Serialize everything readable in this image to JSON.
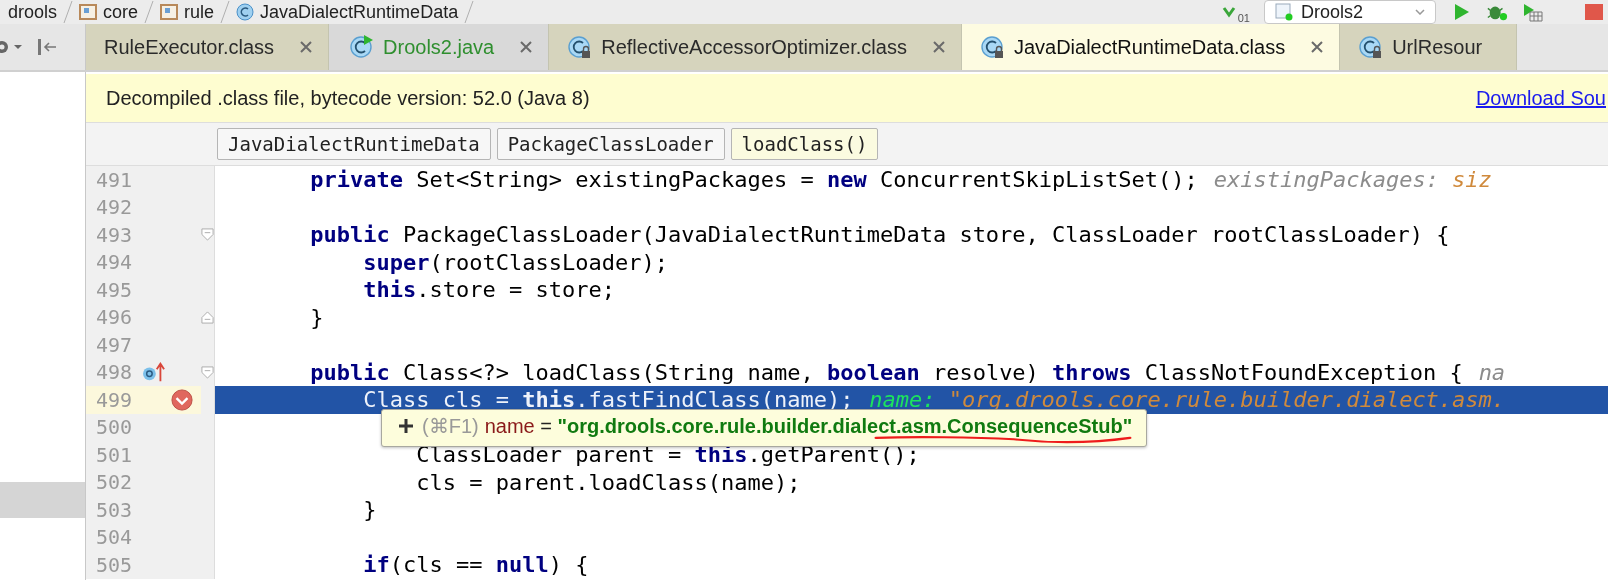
{
  "breadcrumbs": [
    {
      "label": "drools",
      "kind": "module"
    },
    {
      "label": "core",
      "kind": "package"
    },
    {
      "label": "rule",
      "kind": "package"
    },
    {
      "label": "JavaDialectRuntimeData",
      "kind": "class"
    }
  ],
  "toolbar": {
    "vcs_badge": "01",
    "run_config": "Drools2"
  },
  "tabs": [
    {
      "label": "RuleExecutor.class",
      "kind": "class",
      "icon": false,
      "closable": true,
      "selected": false
    },
    {
      "label": "Drools2.java",
      "kind": "java",
      "icon": true,
      "closable": true,
      "selected": false
    },
    {
      "label": "ReflectiveAccessorOptimizer.class",
      "kind": "class",
      "icon": true,
      "closable": true,
      "selected": false
    },
    {
      "label": "JavaDialectRuntimeData.class",
      "kind": "class",
      "icon": true,
      "closable": true,
      "selected": true
    },
    {
      "label": "UrlResour",
      "kind": "class",
      "icon": true,
      "closable": false,
      "selected": false
    }
  ],
  "banner": {
    "message": "Decompiled .class file, bytecode version: 52.0 (Java 8)",
    "link": "Download Sou"
  },
  "crumbs": [
    {
      "label": "JavaDialectRuntimeData",
      "selected": false
    },
    {
      "label": "PackageClassLoader",
      "selected": false
    },
    {
      "label": "loadClass()",
      "selected": true
    }
  ],
  "lines": [
    {
      "number": "491",
      "current": false,
      "fold_start": false,
      "fold_end": false,
      "override": false,
      "breakpoint": false,
      "tokens": [
        {
          "kind": "kw",
          "text": "private"
        },
        {
          "kind": "plain",
          "text": " Set<String> existingPackages = "
        },
        {
          "kind": "kw",
          "text": "new"
        },
        {
          "kind": "plain",
          "text": " ConcurrentSkipListSet();"
        }
      ],
      "hint": {
        "kind": "param",
        "label": "existingPackages:",
        "value": "siz"
      }
    },
    {
      "number": "492",
      "current": false,
      "fold_start": false,
      "fold_end": false,
      "override": false,
      "breakpoint": false
    },
    {
      "number": "493",
      "current": false,
      "fold_start": true,
      "fold_end": false,
      "override": false,
      "breakpoint": false,
      "tokens": [
        {
          "kind": "kw",
          "text": "public"
        },
        {
          "kind": "plain",
          "text": " PackageClassLoader(JavaDialectRuntimeData store, ClassLoader rootClassLoader) {"
        }
      ]
    },
    {
      "number": "494",
      "current": false,
      "fold_start": false,
      "fold_end": false,
      "override": false,
      "breakpoint": false,
      "tokens": [
        {
          "kind": "kw",
          "text": "    super"
        },
        {
          "kind": "plain",
          "text": "(rootClassLoader);"
        }
      ]
    },
    {
      "number": "495",
      "current": false,
      "fold_start": false,
      "fold_end": false,
      "override": false,
      "breakpoint": false,
      "tokens": [
        {
          "kind": "kw",
          "text": "    this"
        },
        {
          "kind": "plain",
          "text": ".store = store;"
        }
      ]
    },
    {
      "number": "496",
      "current": false,
      "fold_start": false,
      "fold_end": true,
      "override": false,
      "breakpoint": false,
      "tokens": [
        {
          "kind": "plain",
          "text": "}"
        }
      ]
    },
    {
      "number": "497",
      "current": false,
      "fold_start": false,
      "fold_end": false,
      "override": false,
      "breakpoint": false
    },
    {
      "number": "498",
      "current": false,
      "fold_start": true,
      "fold_end": false,
      "override": true,
      "breakpoint": false,
      "tokens": [
        {
          "kind": "kw",
          "text": "public"
        },
        {
          "kind": "plain",
          "text": " Class<?> loadClass(String name, "
        },
        {
          "kind": "kw",
          "text": "boolean"
        },
        {
          "kind": "plain",
          "text": " resolve) "
        },
        {
          "kind": "kw",
          "text": "throws"
        },
        {
          "kind": "plain",
          "text": " ClassNotFoundException {"
        }
      ],
      "hint": {
        "kind": "param",
        "label": "na"
      }
    },
    {
      "number": "499",
      "current": true,
      "fold_start": false,
      "fold_end": false,
      "override": false,
      "breakpoint": true,
      "tokens": [
        {
          "kind": "plain",
          "text": "    Class cls = "
        },
        {
          "kind": "kw",
          "text": "this"
        },
        {
          "kind": "plain",
          "text": ".fastFindClass(name);"
        }
      ],
      "hint": {
        "kind": "debug",
        "label": "name:",
        "value": "\"org.drools.core.rule.builder.dialect.asm."
      }
    },
    {
      "number": "500",
      "current": false,
      "fold_start": false,
      "fold_end": false,
      "override": false,
      "breakpoint": false
    },
    {
      "number": "501",
      "current": false,
      "fold_start": false,
      "fold_end": false,
      "override": false,
      "breakpoint": false,
      "tokens": [
        {
          "kind": "plain",
          "text": "        ClassLoader parent = "
        },
        {
          "kind": "kw",
          "text": "this"
        },
        {
          "kind": "plain",
          "text": ".getParent();"
        }
      ]
    },
    {
      "number": "502",
      "current": false,
      "fold_start": false,
      "fold_end": false,
      "override": false,
      "breakpoint": false,
      "tokens": [
        {
          "kind": "plain",
          "text": "        cls = parent.loadClass(name);"
        }
      ]
    },
    {
      "number": "503",
      "current": false,
      "fold_start": false,
      "fold_end": false,
      "override": false,
      "breakpoint": false,
      "tokens": [
        {
          "kind": "plain",
          "text": "    }"
        }
      ]
    },
    {
      "number": "504",
      "current": false,
      "fold_start": false,
      "fold_end": false,
      "override": false,
      "breakpoint": false
    },
    {
      "number": "505",
      "current": false,
      "fold_start": false,
      "fold_end": false,
      "override": false,
      "breakpoint": false,
      "tokens": [
        {
          "kind": "kw",
          "text": "    if"
        },
        {
          "kind": "plain",
          "text": "(cls == "
        },
        {
          "kind": "kw",
          "text": "null"
        },
        {
          "kind": "plain",
          "text": ") {"
        }
      ]
    }
  ],
  "tooltip": {
    "shortcut": "(⌘F1)",
    "name": "name",
    "operator": "=",
    "value": "\"org.drools.core.rule.builder.dialect.asm.ConsequenceStub\""
  }
}
